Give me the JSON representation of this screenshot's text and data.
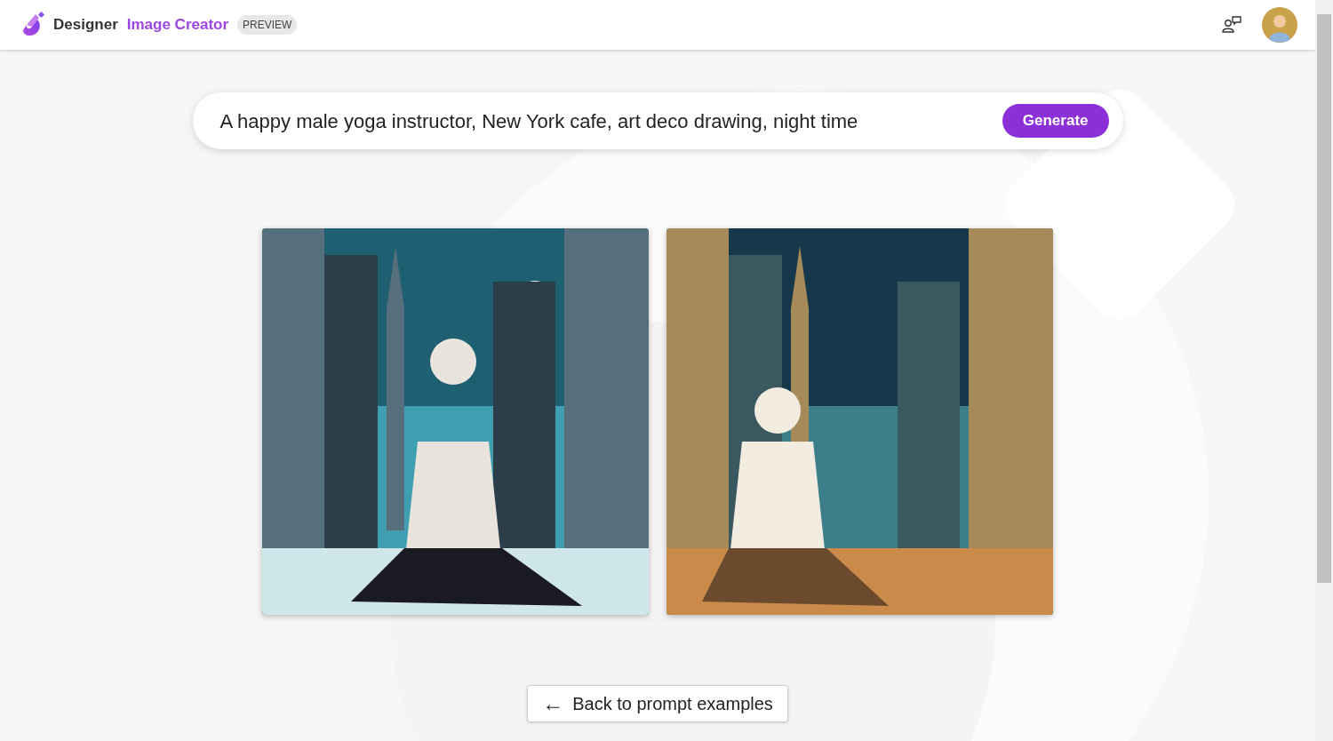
{
  "header": {
    "brand": "Designer",
    "product": "Image Creator",
    "badge": "PREVIEW"
  },
  "prompt": {
    "value": "A happy male yoga instructor, New York cafe, art deco drawing, night time",
    "button": "Generate"
  },
  "back_button": {
    "icon": "←",
    "label": "Back to prompt examples"
  }
}
